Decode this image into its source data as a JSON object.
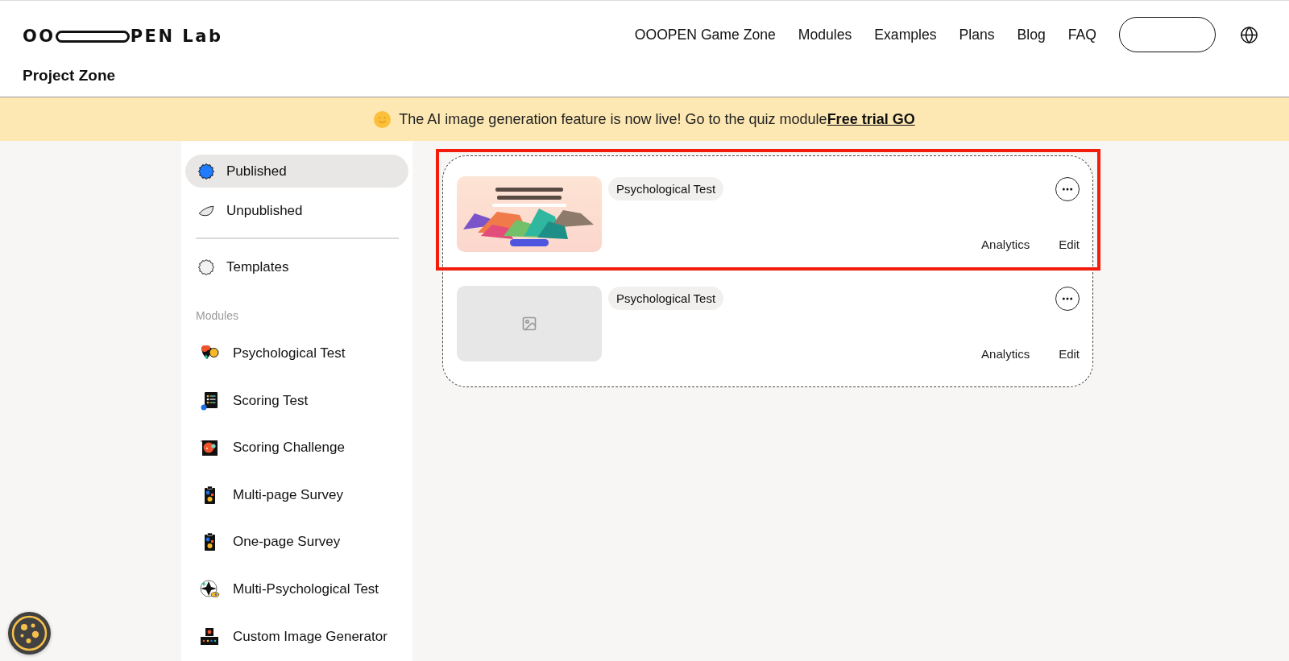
{
  "header": {
    "logo": {
      "start": "OO",
      "end": "PEN Lab"
    },
    "page_title": "Project Zone",
    "nav": [
      {
        "label": "OOOPEN Game Zone"
      },
      {
        "label": "Modules"
      },
      {
        "label": "Examples"
      },
      {
        "label": "Plans"
      },
      {
        "label": "Blog"
      },
      {
        "label": "FAQ"
      }
    ]
  },
  "banner": {
    "text": "The AI image generation feature is now live! Go to the quiz module",
    "link": "Free trial GO"
  },
  "sidebar": {
    "status_items": [
      {
        "label": "Published",
        "kind": "published",
        "selected": true
      },
      {
        "label": "Unpublished",
        "kind": "unpublished",
        "selected": false
      }
    ],
    "templates": {
      "label": "Templates",
      "selected": false
    },
    "modules_heading": "Modules",
    "modules": [
      {
        "label": "Psychological Test",
        "kind": "psychological"
      },
      {
        "label": "Scoring Test",
        "kind": "scoring"
      },
      {
        "label": "Scoring Challenge",
        "kind": "challenge"
      },
      {
        "label": "Multi-page Survey",
        "kind": "survey"
      },
      {
        "label": "One-page Survey",
        "kind": "survey"
      },
      {
        "label": "Multi-Psychological Test",
        "kind": "multipsych"
      },
      {
        "label": "Custom Image Generator",
        "kind": "generator"
      }
    ]
  },
  "projects": [
    {
      "tag": "Psychological Test",
      "thumbnail": {
        "kind": "artwork"
      },
      "highlighted": true,
      "actions": [
        "Analytics",
        "Edit"
      ]
    },
    {
      "tag": "Psychological Test",
      "thumbnail": {
        "kind": "empty"
      },
      "highlighted": false,
      "actions": [
        "Analytics",
        "Edit"
      ]
    }
  ]
}
